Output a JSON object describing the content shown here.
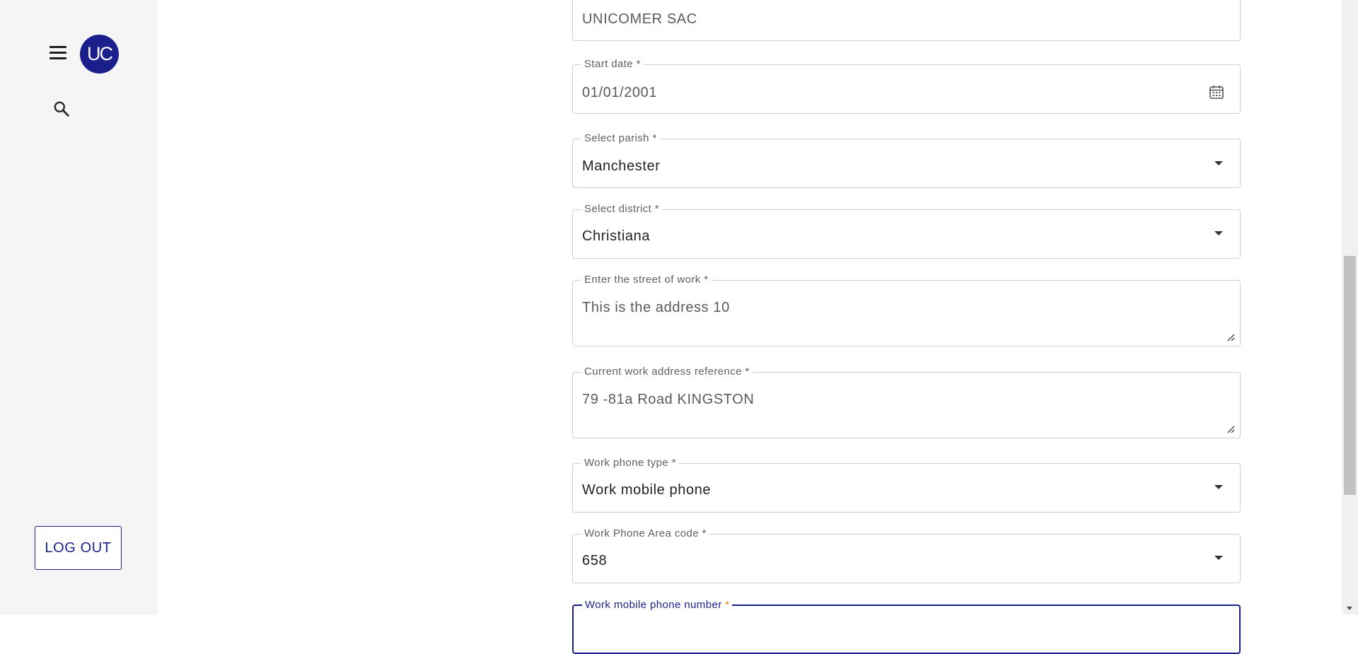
{
  "sidebar": {
    "avatar_initials": "UC",
    "menu_icon": "hamburger-menu-icon",
    "search_icon": "search-icon",
    "logout_label": "LOG OUT"
  },
  "form": {
    "employer": {
      "value": "UNICOMER SAC"
    },
    "start_date": {
      "label": "Start date *",
      "value": "01/01/2001",
      "icon": "calendar-icon"
    },
    "parish": {
      "label": "Select parish *",
      "value": "Manchester"
    },
    "district": {
      "label": "Select district *",
      "value": "Christiana"
    },
    "work_street": {
      "label": "Enter the street of work *",
      "value": "This is the address 10"
    },
    "work_reference": {
      "label": "Current work address reference *",
      "value": "79 -81a Road KINGSTON"
    },
    "work_phone_type": {
      "label": "Work phone type *",
      "value": "Work mobile phone"
    },
    "work_area_code": {
      "label": "Work Phone Area code *",
      "value": "658"
    },
    "work_mobile_number": {
      "label": "Work mobile phone number",
      "required_mark": "*"
    }
  },
  "colors": {
    "brand": "#1a1f8c",
    "sidebar_bg": "#f5f5f5",
    "border": "#cfcfcf",
    "required_star": "#e07b00"
  }
}
